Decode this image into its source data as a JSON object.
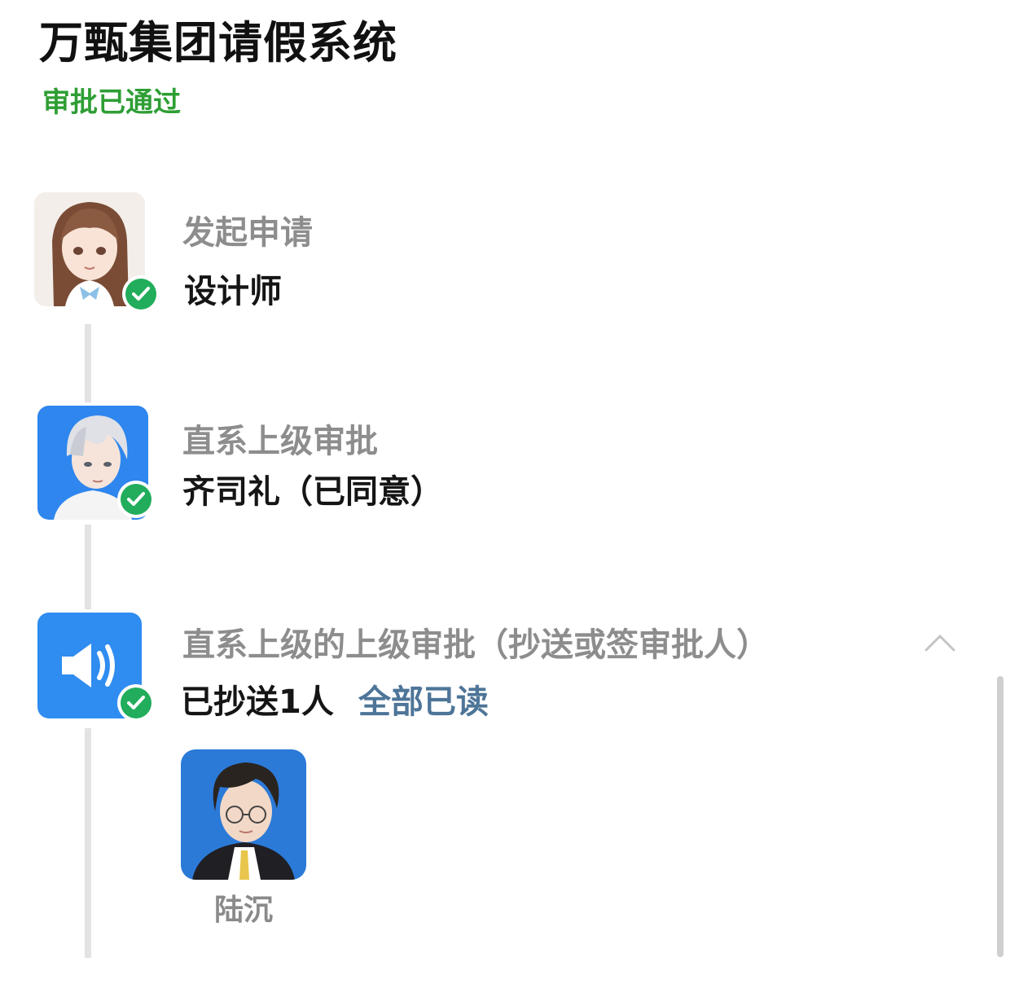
{
  "header": {
    "title": "万甄集团请假系统",
    "status": "审批已通过",
    "status_color": "#2e9e34"
  },
  "steps": [
    {
      "label": "发起申请",
      "value": "设计师",
      "avatar_icon": "female-avatar-icon",
      "status_icon": "check-circle-icon"
    },
    {
      "label": "直系上级审批",
      "value": "齐司礼（已同意）",
      "avatar_icon": "male-avatar-icon",
      "status_icon": "check-circle-icon"
    },
    {
      "label": "直系上级的上级审批（抄送或签审批人）",
      "value": "已抄送1人",
      "link": "全部已读",
      "avatar_icon": "speaker-icon",
      "status_icon": "check-circle-icon",
      "collapse_icon": "chevron-up-icon",
      "cc_people": [
        {
          "name": "陆沉",
          "avatar_icon": "male-avatar-glasses-icon"
        }
      ]
    }
  ],
  "colors": {
    "accent_blue": "#2f8cf0",
    "check_green": "#21ad5b",
    "link_blue": "#4d7598",
    "label_gray": "#8d8d8d"
  }
}
